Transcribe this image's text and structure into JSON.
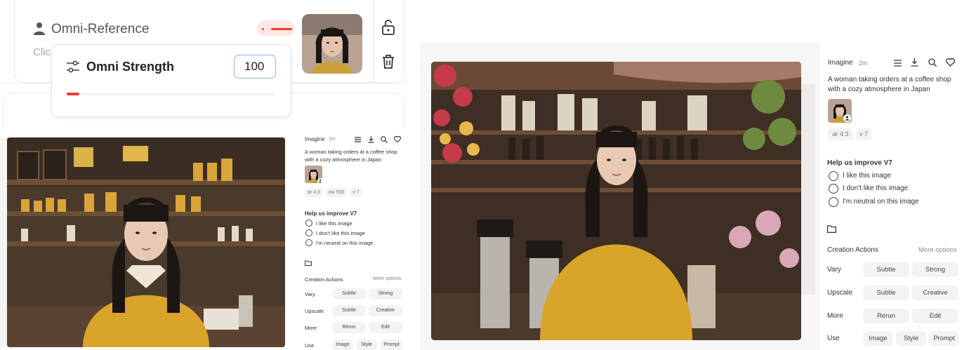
{
  "omni": {
    "title": "Omni-Reference",
    "subtitle": "Clic",
    "strength_label": "Omni Strength",
    "strength_value": "100",
    "strength_fraction": 0.06
  },
  "viewer_small": {
    "mode": "Imagine",
    "age": "1m",
    "prompt": "A woman taking orders at a coffee shop with a cozy atmosphere in Japan",
    "params": [
      "ar 4:3",
      "ow 500",
      "v 7"
    ],
    "feedback_title": "Help us improve V7",
    "feedback_options": [
      "I like this image",
      "I don't like this image",
      "I'm neutral on this image"
    ],
    "creation_title": "Creation Actions",
    "more_options": "More options",
    "rows": [
      {
        "label": "Vary",
        "buttons": [
          "Subtle",
          "Strong"
        ]
      },
      {
        "label": "Upscale",
        "buttons": [
          "Subtle",
          "Creative"
        ]
      },
      {
        "label": "More",
        "buttons": [
          "Rerun",
          "Edit"
        ]
      },
      {
        "label": "Use",
        "buttons": [
          "Image",
          "Style",
          "Prompt"
        ]
      }
    ]
  },
  "viewer_large": {
    "mode": "Imagine",
    "age": "2m",
    "prompt": "A woman taking orders at a coffee shop with a cozy atmosphere in Japan",
    "params": [
      "ar 4:3",
      "v 7"
    ],
    "feedback_title": "Help us improve V7",
    "feedback_options": [
      "I like this image",
      "I don't like this image",
      "I'm neutral on this image"
    ],
    "creation_title": "Creation Actions",
    "more_options": "More options",
    "rows": [
      {
        "label": "Vary",
        "buttons": [
          "Subtle",
          "Strong"
        ]
      },
      {
        "label": "Upscale",
        "buttons": [
          "Subtle",
          "Creative"
        ]
      },
      {
        "label": "More",
        "buttons": [
          "Rerun",
          "Edit"
        ]
      },
      {
        "label": "Use",
        "buttons": [
          "Image",
          "Style",
          "Prompt"
        ]
      }
    ]
  },
  "colors": {
    "accent": "#e5402b",
    "sweater": "#d8a42a",
    "hair": "#1c1613"
  }
}
